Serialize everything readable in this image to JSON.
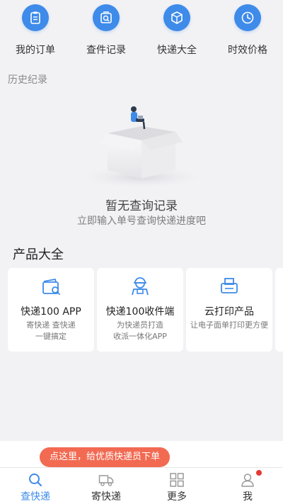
{
  "quick_actions": [
    {
      "label": "我的订单",
      "icon": "clipboard-icon"
    },
    {
      "label": "查件记录",
      "icon": "search-package-icon"
    },
    {
      "label": "快递大全",
      "icon": "box-icon"
    },
    {
      "label": "时效价格",
      "icon": "clock-icon"
    }
  ],
  "history": {
    "section_title": "历史纪录",
    "empty_title": "暂无查询记录",
    "empty_subtitle": "立即输入单号查询快递进度吧"
  },
  "products": {
    "section_title": "产品大全",
    "items": [
      {
        "name": "快递100 APP",
        "desc_line1": "寄快递 查快递",
        "desc_line2": "一键搞定",
        "icon": "wallet-search-icon"
      },
      {
        "name": "快递100收件端",
        "desc_line1": "为快递员打造",
        "desc_line2": "收派一体化APP",
        "icon": "courier-icon"
      },
      {
        "name": "云打印产品",
        "desc_line1": "让电子面单打印更方便",
        "desc_line2": "",
        "icon": "printer-icon"
      }
    ]
  },
  "promo_text": "点这里，给优质快递员下单",
  "tabs": [
    {
      "label": "查快递",
      "icon": "search-icon",
      "active": true
    },
    {
      "label": "寄快递",
      "icon": "truck-icon",
      "active": false
    },
    {
      "label": "更多",
      "icon": "grid-icon",
      "active": false
    },
    {
      "label": "我",
      "icon": "user-icon",
      "active": false
    }
  ],
  "colors": {
    "accent": "#3e8be9",
    "promo": "#f26a52",
    "badge": "#e53935"
  }
}
